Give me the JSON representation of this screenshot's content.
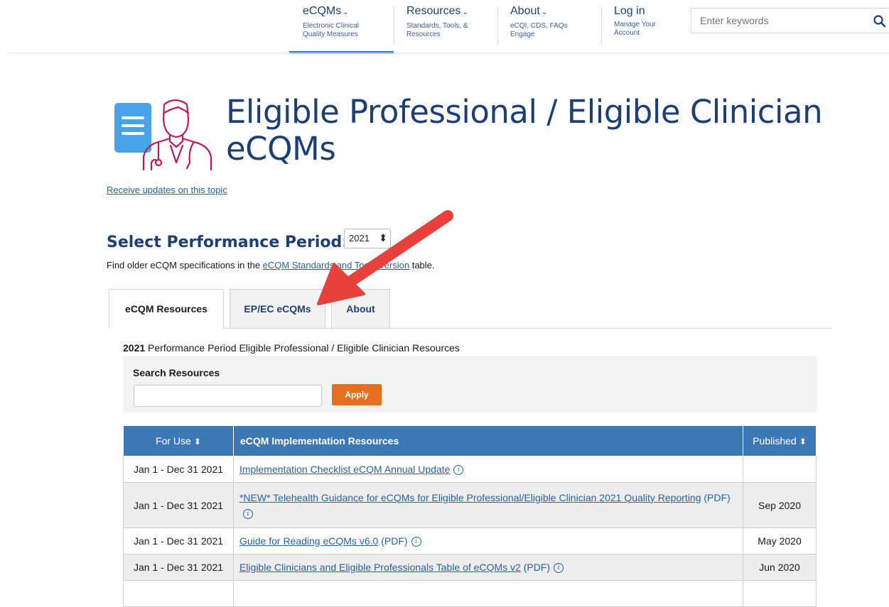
{
  "nav": {
    "items": [
      {
        "title": "eCQMs",
        "subtitle": "Electronic Clinical Quality Measures"
      },
      {
        "title": "Resources",
        "subtitle": "Standards, Tools, & Resources"
      },
      {
        "title": "About",
        "subtitle": "eCQI, CDS, FAQs Engage"
      },
      {
        "title": "Log in",
        "subtitle": "Manage Your Account"
      }
    ],
    "search_placeholder": "Enter keywords",
    "icons": [
      "chevron-down-icon",
      "search-icon"
    ]
  },
  "page": {
    "title": "Eligible Professional / Eligible Clinician eCQMs",
    "updates_link": "Receive updates on this topic",
    "period_heading": "Select Performance Period:",
    "period_value": "2021",
    "older_prefix": "Find older eCQM specifications in the ",
    "older_link": "eCQM Standards and Tools Version",
    "older_suffix": " table.",
    "hero_icons": [
      "list-document-icon",
      "clinician-icon"
    ]
  },
  "tabs": [
    {
      "label": "eCQM Resources",
      "active": true
    },
    {
      "label": "EP/EC eCQMs",
      "active": false
    },
    {
      "label": "About",
      "active": false
    }
  ],
  "resources": {
    "caption_year": "2021",
    "caption_text": " Performance Period Eligible Professional / Eligible Clinician Resources",
    "search_label": "Search Resources",
    "apply_label": "Apply",
    "columns": [
      "For Use",
      "eCQM Implementation Resources",
      "Published"
    ],
    "rows": [
      {
        "for_use": "Jan 1 - Dec 31 2021",
        "title": "Implementation Checklist eCQM Annual Update",
        "suffix": "",
        "published": ""
      },
      {
        "for_use": "Jan 1 - Dec 31 2021",
        "title": "*NEW* Telehealth Guidance for eCQMs for Eligible Professional/Eligible Clinician 2021 Quality Reporting",
        "suffix": "(PDF)",
        "published": "Sep 2020"
      },
      {
        "for_use": "Jan 1 - Dec 31 2021",
        "title": "Guide for Reading eCQMs v6.0",
        "suffix": "(PDF)",
        "published": "May 2020"
      },
      {
        "for_use": "Jan 1 - Dec 31 2021",
        "title": "Eligible Clinicians and Eligible Professionals Table of eCQMs v2",
        "suffix": "(PDF)",
        "published": "Jun 2020"
      }
    ]
  },
  "colors": {
    "brand_navy": "#1d3f73",
    "link_blue": "#2563a6",
    "table_header": "#3c78b5",
    "apply_orange": "#e2701f",
    "annotation_red": "#e8413b",
    "icon_pink": "#c2185b",
    "icon_blue": "#4aa3e8"
  }
}
